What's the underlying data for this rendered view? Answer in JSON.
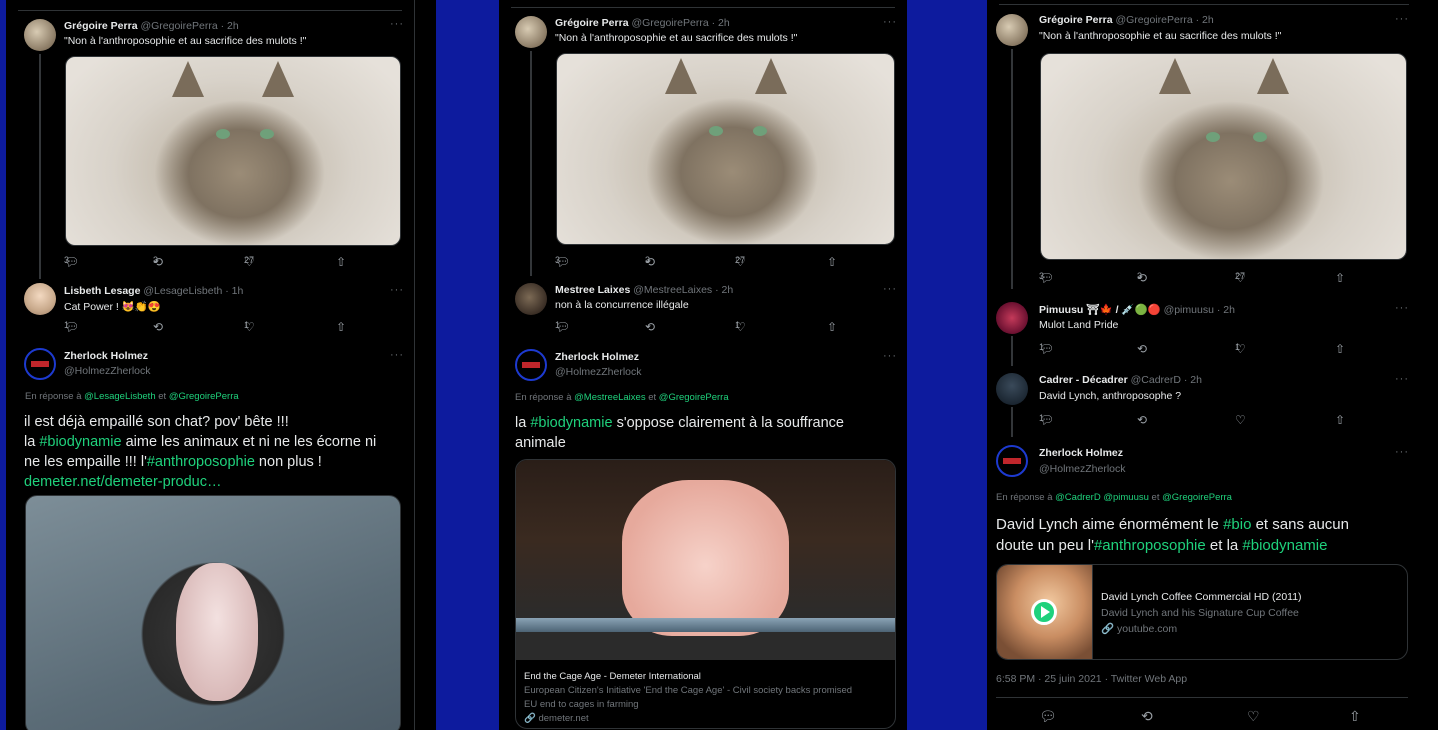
{
  "shared": {
    "greg_name": "Grégoire Perra",
    "greg_handle": "@GregoirePerra · 2h",
    "greg_text": "\"Non à l'anthroposophie et au sacrifice des mulots !\"",
    "replies": "3",
    "retweets": "3",
    "likes": "27",
    "zh_name": "Zherlock Holmez",
    "zh_handle": "@HolmezZherlock",
    "more": "···"
  },
  "icons": [
    "reply-icon",
    "retweet-icon",
    "like-icon",
    "share-icon"
  ],
  "p1": {
    "lis_name": "Lisbeth Lesage",
    "lis_handle": "@LesageLisbeth · 1h",
    "lis_text": "Cat Power ! 😻👏😍",
    "lis_replies": "1",
    "lis_likes": "1",
    "reply_label": "En réponse à",
    "reply_u1": "@LesageLisbeth",
    "reply_et": "et",
    "reply_u2": "@GregoirePerra",
    "l1": "il est déjà empaillé son chat? pov' bête !!!",
    "l2a": "la ",
    "l2b": "#biodynamie",
    "l2c": " aime les animaux et ni ne les écorne ni",
    "l3a": "ne les empaille !!! l'",
    "l3b": "#anthroposophie",
    "l3c": " non plus !",
    "l4": "demeter.net/demeter-produc…"
  },
  "p2": {
    "mes_name": "Mestree Laixes",
    "mes_handle": "@MestreeLaixes · 2h",
    "mes_text": "non à la concurrence illégale",
    "mes_replies": "1",
    "mes_likes": "1",
    "reply_label": "En réponse à",
    "reply_u1": "@MestreeLaixes",
    "reply_et": "et",
    "reply_u2": "@GregoirePerra",
    "l1a": "la ",
    "l1b": "#biodynamie",
    "l1c": " s'oppose clairement à la souffrance",
    "l2": "animale",
    "card_title": "End the Cage Age - Demeter International",
    "card_desc1": "European Citizen's Initiative 'End the Cage Age' - Civil society backs promised",
    "card_desc2": "EU end to cages in farming",
    "card_domain": "🔗 demeter.net"
  },
  "p3": {
    "pim_name": "Pimuusu ⛩🍁 / 💉🟢🔴",
    "pim_handle": "@pimuusu · 2h",
    "pim_text": "Mulot Land Pride",
    "pim_replies": "1",
    "pim_likes": "1",
    "cad_name": "Cadrer - Décadrer",
    "cad_handle": "@CadrerD · 2h",
    "cad_text": "David Lynch, anthroposophe ?",
    "cad_replies": "1",
    "reply_label": "En réponse à",
    "reply_u1": "@CadrerD",
    "reply_u2": "@pimuusu",
    "reply_et": "et",
    "reply_u3": "@GregoirePerra",
    "l1a": "David Lynch aime énormément le ",
    "l1b": "#bio",
    "l1c": " et sans aucun",
    "l2a": "doute un peu l'",
    "l2b": "#anthroposophie",
    "l2c": " et la ",
    "l2d": "#biodynamie",
    "card_title": "David Lynch Coffee Commercial HD (2011)",
    "card_desc": "David Lynch and his Signature Cup Coffee",
    "card_domain": "🔗 youtube.com",
    "timestamp": "6:58 PM · 25 juin 2021 · Twitter Web App"
  },
  "colors": {
    "accent": "#1fd17c",
    "background": "#0d1b9e",
    "panel": "#000000"
  }
}
